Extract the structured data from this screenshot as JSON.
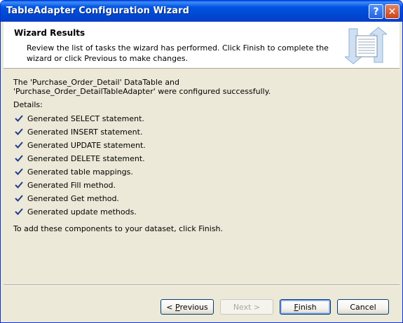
{
  "window": {
    "title": "TableAdapter Configuration Wizard",
    "help_glyph": "?",
    "close_glyph": "✕"
  },
  "header": {
    "title": "Wizard Results",
    "description": "Review the list of tasks the wizard has performed. Click Finish to complete the wizard or click Previous to make changes."
  },
  "body": {
    "message": "The 'Purchase_Order_Detail' DataTable and 'Purchase_Order_DetailTableAdapter' were configured successfully.",
    "details_label": "Details:",
    "tasks": [
      {
        "label": "Generated SELECT statement."
      },
      {
        "label": "Generated INSERT statement."
      },
      {
        "label": "Generated UPDATE statement."
      },
      {
        "label": "Generated DELETE statement."
      },
      {
        "label": "Generated table mappings."
      },
      {
        "label": "Generated Fill method."
      },
      {
        "label": "Generated Get method."
      },
      {
        "label": "Generated update methods."
      }
    ],
    "footer_text": "To add these components to your dataset, click Finish."
  },
  "buttons": {
    "previous_prefix": "< ",
    "previous_mnemonic": "P",
    "previous_rest": "revious",
    "next_label": "Next >",
    "finish_mnemonic": "F",
    "finish_rest": "inish",
    "cancel_label": "Cancel"
  },
  "colors": {
    "title_bar": "#0054e3",
    "dialog_bg": "#ece9d8",
    "check": "#1f3b8c"
  }
}
